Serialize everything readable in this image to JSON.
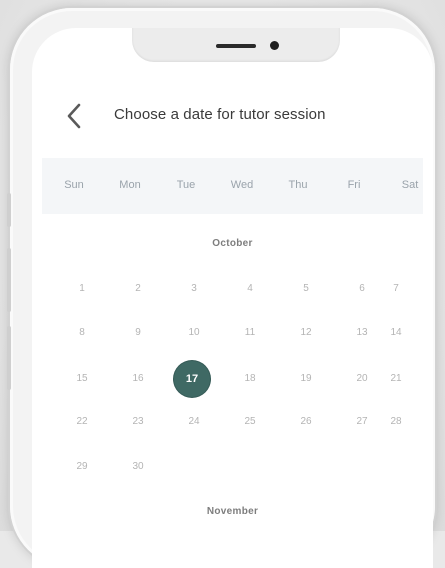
{
  "header": {
    "title": "Choose a date for tutor session"
  },
  "icons": {
    "back": "chevron-left-icon"
  },
  "weekdays": [
    "Sun",
    "Mon",
    "Tue",
    "Wed",
    "Thu",
    "Fri",
    "Sat"
  ],
  "calendar": {
    "months": [
      {
        "name": "October",
        "days": [
          "1",
          "2",
          "3",
          "4",
          "5",
          "6",
          "7",
          "8",
          "9",
          "10",
          "11",
          "12",
          "13",
          "14",
          "15",
          "16",
          "17",
          "18",
          "19",
          "20",
          "21",
          "22",
          "23",
          "24",
          "25",
          "26",
          "27",
          "28",
          "29",
          "30"
        ],
        "selected_day": "17"
      },
      {
        "name": "November"
      }
    ]
  },
  "colors": {
    "accent": "#3f6964",
    "weekbar_bg": "#f4f6f8"
  }
}
